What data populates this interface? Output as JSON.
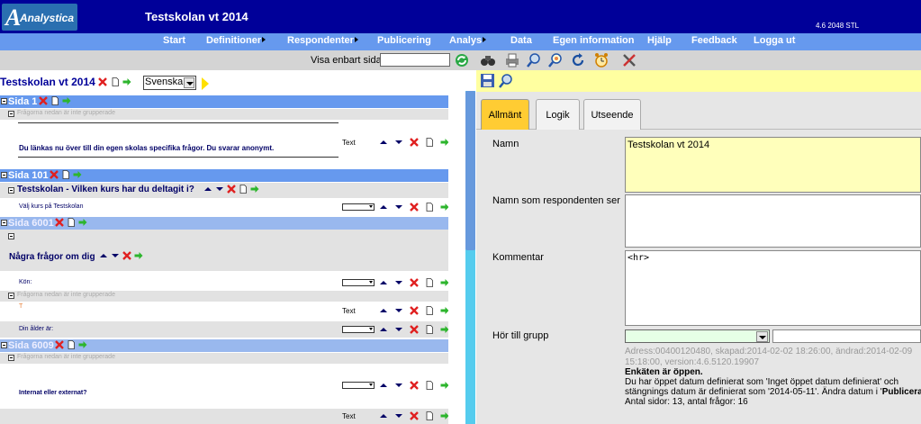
{
  "header": {
    "logo_text": "Analystica",
    "title": "Testskolan vt 2014",
    "version": "4.6 2048 STL"
  },
  "menu": [
    {
      "label": "Start",
      "has_submenu": false
    },
    {
      "label": "Definitioner",
      "has_submenu": true
    },
    {
      "label": "Respondenter",
      "has_submenu": true
    },
    {
      "label": "Publicering",
      "has_submenu": false
    },
    {
      "label": "Analys",
      "has_submenu": true
    },
    {
      "label": "Data",
      "has_submenu": false
    },
    {
      "label": "Egen information",
      "has_submenu": false
    },
    {
      "label": "Hjälp",
      "has_submenu": false
    },
    {
      "label": "Feedback",
      "has_submenu": false
    },
    {
      "label": "Logga ut",
      "has_submenu": false
    }
  ],
  "toolbar": {
    "only_page_label": "Visa enbart sida",
    "only_page_value": "",
    "icons": [
      "refresh-icon",
      "binoculars-icon",
      "print-icon",
      "zoom-in-icon",
      "zoom-find-icon",
      "reload-icon",
      "alarm-clock-icon",
      "tools-icon"
    ]
  },
  "survey": {
    "title": "Testskolan vt 2014",
    "language": "Svenska",
    "pages": {
      "p1": "Sida 1",
      "p101": "Sida 101",
      "p6001": "Sida 6001",
      "p6009": "Sida 6009"
    },
    "ungrouped": "Frågorna nedan är inte grupperade",
    "intro_text": "Du länkas nu över till din egen skolas specifika frågor. Du svarar anonymt.",
    "intro_type": "Text",
    "group_testskolan": "Testskolan - Vilken kurs har du deltagit i?",
    "q_kurs": "Välj kurs på Testskolan",
    "group_nagra": "Några frågor om dig",
    "q_kon": "Kön:",
    "q_t": "T",
    "q_t_type": "Text",
    "q_alder": "Din ålder är:",
    "q_internat": "Internat eller externat?",
    "last_type": "Text"
  },
  "detail": {
    "tabs": [
      {
        "label": "Allmänt",
        "active": true
      },
      {
        "label": "Logik",
        "active": false
      },
      {
        "label": "Utseende",
        "active": false
      }
    ],
    "name_label": "Namn",
    "name_value": "Testskolan vt 2014",
    "resp_name_label": "Namn som respondenten ser",
    "resp_name_value": "",
    "comment_label": "Kommentar",
    "comment_value": "<hr>",
    "group_label": "Hör till grupp",
    "group_value": "",
    "meta_line1": "Adress:00400120480, skapad:2014-02-02 18:26:00, ändrad:2014-02-09",
    "meta_line2": "15:18:00, version:4.6.5120.19907",
    "status_open": "Enkäten är öppen.",
    "info_line1": "Du har öppet datum definierat som 'Inget öppet datum definierat' och",
    "info_line2_a": "stängnings datum är definierat som '2014-05-11'. Ändra datum i '",
    "info_line2_b": "Publicera",
    "counts": "Antal sidor: 13, antal frågor: 16"
  },
  "colors": {
    "header_bg": "#000099",
    "menu_bg": "#6699ee",
    "page_bar": "#6699ee",
    "active_tab": "#ffcc33",
    "name_field_bg": "#ffffbb"
  }
}
